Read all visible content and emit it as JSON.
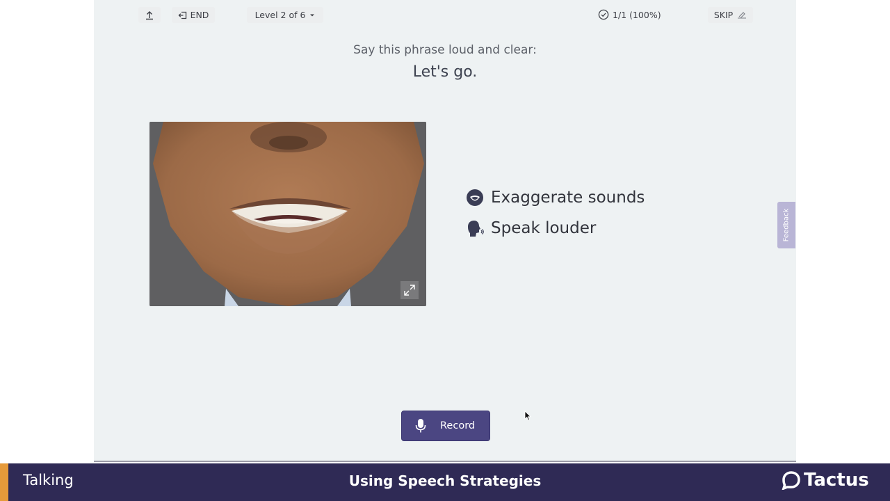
{
  "topbar": {
    "end_label": "END",
    "level_label": "Level 2 of 6",
    "progress_text": "1/1 (100%)",
    "skip_label": "SKIP"
  },
  "exercise": {
    "prompt": "Say this phrase loud and clear:",
    "phrase": "Let's go."
  },
  "strategies": [
    {
      "label": "Exaggerate sounds",
      "icon": "mouth-icon"
    },
    {
      "label": "Speak louder",
      "icon": "speaking-head-icon"
    }
  ],
  "feedback_label": "Feedback",
  "record_label": "Record",
  "footer": {
    "left_label": "Talking",
    "title": "Using Speech Strategies",
    "brand": "Tactus"
  },
  "colors": {
    "primary": "#4b4682",
    "footer_bg": "#2f2a55",
    "accent": "#e69a3a"
  }
}
